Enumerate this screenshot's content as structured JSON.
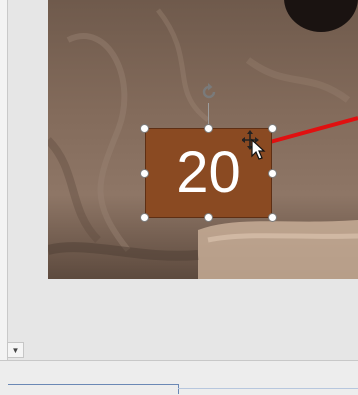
{
  "slide": {
    "shape_text": "20",
    "shape_fill": "#8a4a22",
    "pointer_line_color": "#e01010"
  },
  "icons": {
    "rotate": "rotate-icon",
    "move_cursor": "move-cursor-icon",
    "scroll_down": "chevron-down-icon"
  },
  "scroll": {
    "arrow_glyph": "▼"
  }
}
